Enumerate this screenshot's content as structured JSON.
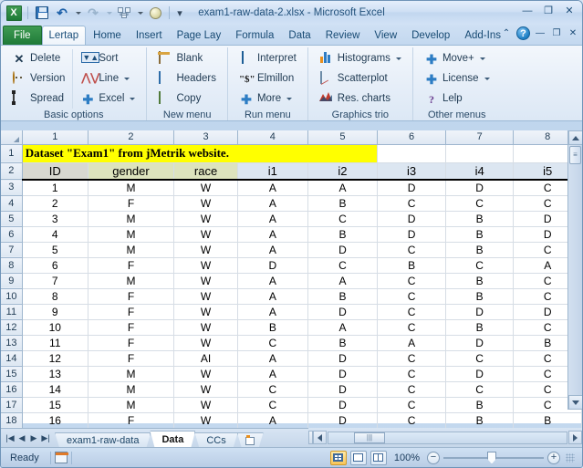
{
  "window": {
    "title": "exam1-raw-data-2.xlsx  -  Microsoft Excel",
    "minimize": "—",
    "restore": "❐",
    "close": "✕"
  },
  "quick_access": {
    "app_logo": "X",
    "save": "save-icon",
    "undo": "↰",
    "redo": "↱",
    "print_preview": "print-icon",
    "sphere": "orb-icon",
    "customize": "▾"
  },
  "ribbon": {
    "tabs": [
      {
        "label": "File",
        "active": false,
        "kind": "file"
      },
      {
        "label": "Lertap",
        "active": true,
        "kind": "normal"
      },
      {
        "label": "Home",
        "active": false,
        "kind": "normal"
      },
      {
        "label": "Insert",
        "active": false,
        "kind": "normal"
      },
      {
        "label": "Page Lay",
        "active": false,
        "kind": "normal"
      },
      {
        "label": "Formula",
        "active": false,
        "kind": "normal"
      },
      {
        "label": "Data",
        "active": false,
        "kind": "normal"
      },
      {
        "label": "Review",
        "active": false,
        "kind": "normal"
      },
      {
        "label": "View",
        "active": false,
        "kind": "normal"
      },
      {
        "label": "Develop",
        "active": false,
        "kind": "normal"
      },
      {
        "label": "Add-Ins",
        "active": false,
        "kind": "normal"
      }
    ],
    "right_controls": {
      "collapse_ribbon": "⌃",
      "help": "?",
      "min": "—",
      "restore": "❐",
      "close": "✕"
    },
    "groups": [
      {
        "title": "Basic options",
        "columns": [
          [
            {
              "label": "Delete",
              "icon": "delete-x-icon",
              "dropdown": false
            },
            {
              "label": "Version",
              "icon": "smiley-icon",
              "dropdown": false
            },
            {
              "label": "Spread",
              "icon": "spread-icon",
              "dropdown": false
            }
          ],
          [
            {
              "label": "Sort",
              "icon": "sort-icon",
              "dropdown": false
            },
            {
              "label": "Line",
              "icon": "line-chart-icon",
              "dropdown": true
            },
            {
              "label": "Excel",
              "icon": "plus-icon",
              "dropdown": true
            }
          ]
        ]
      },
      {
        "title": "New menu",
        "columns": [
          [
            {
              "label": "Blank",
              "icon": "blank-sheet-icon",
              "dropdown": false
            },
            {
              "label": "Headers",
              "icon": "headers-icon",
              "dropdown": false
            },
            {
              "label": "Copy",
              "icon": "copy-icon",
              "dropdown": false
            }
          ]
        ]
      },
      {
        "title": "Run menu",
        "columns": [
          [
            {
              "label": "Interpret",
              "icon": "interpret-icon",
              "dropdown": false
            },
            {
              "label": "Elmillon",
              "icon": "dollar-icon",
              "dropdown": false
            },
            {
              "label": "More",
              "icon": "plus-icon",
              "dropdown": true
            }
          ]
        ]
      },
      {
        "title": "Graphics trio",
        "columns": [
          [
            {
              "label": "Histograms",
              "icon": "histogram-icon",
              "dropdown": true
            },
            {
              "label": "Scatterplot",
              "icon": "scatterplot-icon",
              "dropdown": false
            },
            {
              "label": "Res. charts",
              "icon": "res-charts-icon",
              "dropdown": false
            }
          ]
        ]
      },
      {
        "title": "Other menus",
        "columns": [
          [
            {
              "label": "Move+",
              "icon": "plus-icon",
              "dropdown": true
            },
            {
              "label": "License",
              "icon": "plus-icon",
              "dropdown": true
            },
            {
              "label": "Lelp",
              "icon": "question-icon",
              "dropdown": false
            }
          ]
        ]
      }
    ]
  },
  "grid": {
    "column_headers": [
      "1",
      "2",
      "3",
      "4",
      "5",
      "6",
      "7",
      "8"
    ],
    "row_headers": [
      "1",
      "2",
      "3",
      "4",
      "5",
      "6",
      "7",
      "8",
      "9",
      "10",
      "11",
      "12",
      "13",
      "14",
      "15",
      "16",
      "17",
      "18"
    ],
    "title_text": "Dataset \"Exam1\" from jMetrik website.",
    "header_labels": [
      "ID",
      "gender",
      "race",
      "i1",
      "i2",
      "i3",
      "i4",
      "i5"
    ],
    "header_fills": [
      "gray",
      "olive",
      "olive",
      "blue",
      "blue",
      "blue",
      "blue",
      "blue"
    ],
    "rows": [
      [
        "1",
        "M",
        "W",
        "A",
        "A",
        "D",
        "D",
        "C"
      ],
      [
        "2",
        "F",
        "W",
        "A",
        "B",
        "C",
        "C",
        "C"
      ],
      [
        "3",
        "M",
        "W",
        "A",
        "C",
        "D",
        "B",
        "D"
      ],
      [
        "4",
        "M",
        "W",
        "A",
        "B",
        "D",
        "B",
        "D"
      ],
      [
        "5",
        "M",
        "W",
        "A",
        "D",
        "C",
        "B",
        "C"
      ],
      [
        "6",
        "F",
        "W",
        "D",
        "C",
        "B",
        "C",
        "A"
      ],
      [
        "7",
        "M",
        "W",
        "A",
        "A",
        "C",
        "B",
        "C"
      ],
      [
        "8",
        "F",
        "W",
        "A",
        "B",
        "C",
        "B",
        "C"
      ],
      [
        "9",
        "F",
        "W",
        "A",
        "D",
        "C",
        "D",
        "D"
      ],
      [
        "10",
        "F",
        "W",
        "B",
        "A",
        "C",
        "B",
        "C"
      ],
      [
        "11",
        "F",
        "W",
        "C",
        "B",
        "A",
        "D",
        "B"
      ],
      [
        "12",
        "F",
        "AI",
        "A",
        "D",
        "C",
        "C",
        "C"
      ],
      [
        "13",
        "M",
        "W",
        "A",
        "D",
        "C",
        "D",
        "C"
      ],
      [
        "14",
        "M",
        "W",
        "C",
        "D",
        "C",
        "C",
        "C"
      ],
      [
        "15",
        "M",
        "W",
        "C",
        "D",
        "C",
        "B",
        "C"
      ],
      [
        "16",
        "F",
        "W",
        "A",
        "D",
        "C",
        "B",
        "B"
      ]
    ]
  },
  "sheet_tabs": {
    "nav": {
      "first": "|◀",
      "prev": "◀",
      "next": "▶",
      "last": "▶|"
    },
    "tabs": [
      {
        "label": "exam1-raw-data",
        "active": false
      },
      {
        "label": "Data",
        "active": true
      },
      {
        "label": "CCs",
        "active": false
      }
    ],
    "new_sheet": "new-sheet-icon"
  },
  "status": {
    "mode": "Ready",
    "macro_record": "record-macro-icon",
    "views": [
      {
        "name": "normal-view",
        "selected": true
      },
      {
        "name": "page-layout-view",
        "selected": false
      },
      {
        "name": "page-break-view",
        "selected": false
      }
    ],
    "zoom": "100%",
    "zoom_out": "−",
    "zoom_in": "+"
  },
  "colors": {
    "accent": "#1f4e79",
    "title_highlight": "#ffff00",
    "file_tab_green": "#1f7a38",
    "header_gray": "#d8d8d0",
    "header_olive": "#dde3bd",
    "header_blue": "#dce6f1"
  }
}
